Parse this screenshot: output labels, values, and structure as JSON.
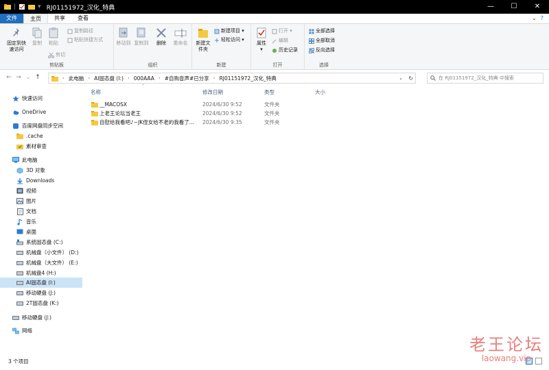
{
  "window": {
    "title": "RJ01151972_汉化_特典",
    "minimize": "—",
    "maximize": "☐",
    "close": "✕"
  },
  "ribbon_tabs": {
    "file": "文件",
    "home": "主页",
    "share": "共享",
    "view": "查看"
  },
  "ribbon": {
    "clipboard": {
      "pin_quick_access": "固定到快速访问",
      "copy": "复制",
      "paste": "粘贴",
      "copy_path": "复制路径",
      "paste_shortcut": "粘贴快捷方式",
      "cut": "剪切",
      "group_label": "剪贴板"
    },
    "organize": {
      "move_to": "移动到",
      "copy_to": "复制到",
      "delete": "删除",
      "rename": "重命名",
      "group_label": "组织"
    },
    "new": {
      "new_folder": "新建文件夹",
      "new_item": "新建项目",
      "easy_access": "轻松访问",
      "group_label": "新建"
    },
    "open": {
      "properties": "属性",
      "open": "打开",
      "edit": "编辑",
      "history": "历史记录",
      "group_label": "打开"
    },
    "select": {
      "select_all": "全部选择",
      "select_none": "全部取消",
      "invert": "反向选择",
      "group_label": "选择"
    }
  },
  "address": {
    "breadcrumbs": [
      "此电脑",
      "AI固态盘 (I:)",
      "000AAA",
      "#自购音声#已分享",
      "RJ01151972_汉化_特典"
    ],
    "search_placeholder": "在 RJ01151972_汉化_特典 中搜索"
  },
  "nav": {
    "items": [
      {
        "label": "快速访问"
      },
      {
        "label": "OneDrive"
      },
      {
        "label": "百度网盘同步空间"
      },
      {
        "label": ".cache"
      },
      {
        "label": "素材审查"
      },
      {
        "label": "此电脑"
      },
      {
        "label": "3D 对象"
      },
      {
        "label": "Downloads"
      },
      {
        "label": "视频"
      },
      {
        "label": "图片"
      },
      {
        "label": "文档"
      },
      {
        "label": "音乐"
      },
      {
        "label": "桌面"
      },
      {
        "label": "系统固态盘 (C:)"
      },
      {
        "label": "机械盘（小文件） (D:)"
      },
      {
        "label": "机械盘（大文件） (E:)"
      },
      {
        "label": "机械盘4 (H:)"
      },
      {
        "label": "AI固态盘 (I:)"
      },
      {
        "label": "移动硬盘 (J:)"
      },
      {
        "label": "2T固态盘 (K:)"
      },
      {
        "label": "移动硬盘 (J:)"
      },
      {
        "label": "网络"
      }
    ]
  },
  "columns": {
    "name": "名称",
    "date": "修改日期",
    "type": "类型",
    "size": "大小"
  },
  "files": [
    {
      "name": "__MACOSX",
      "date": "2024/6/30 9:52",
      "type": "文件夹"
    },
    {
      "name": "上老王论坛当老王",
      "date": "2024/6/30 9:52",
      "type": "文件夹"
    },
    {
      "name": "自慰给我看吧♪~JK侄女给不老的我看了...",
      "date": "2024/6/30 9:35",
      "type": "文件夹"
    }
  ],
  "status": {
    "item_count": "3 个项目"
  },
  "watermark": {
    "text": "老王论坛",
    "url": "laowang.vip"
  },
  "colors": {
    "accent": "#1f6fbf",
    "selected": "#cce4f7",
    "folder": "#f5c842",
    "watermark": "#e8807a"
  }
}
